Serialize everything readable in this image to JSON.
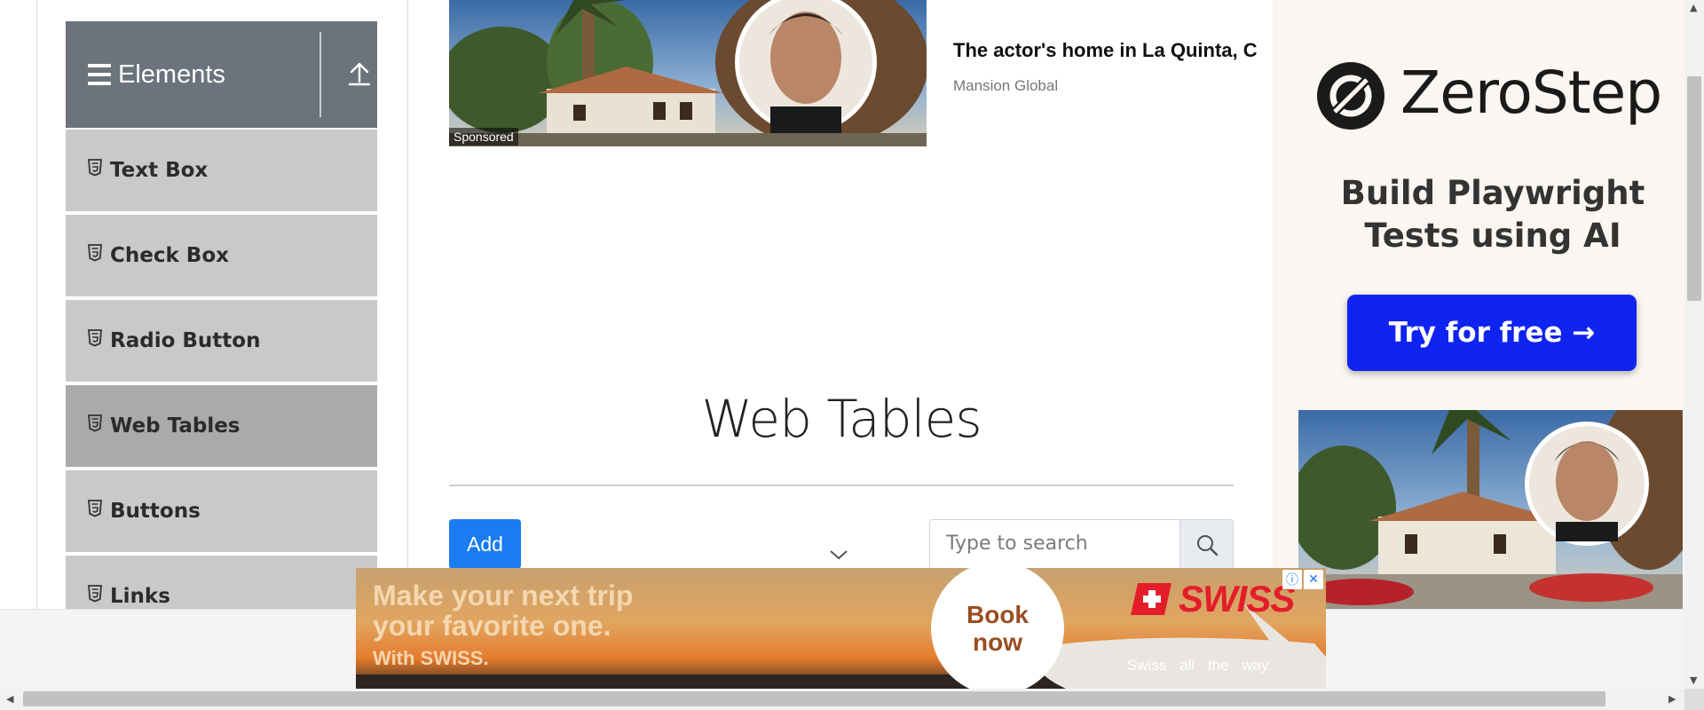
{
  "sidebar": {
    "header_title": "Elements",
    "items": [
      {
        "label": "Text Box"
      },
      {
        "label": "Check Box"
      },
      {
        "label": "Radio Button"
      },
      {
        "label": "Web Tables"
      },
      {
        "label": "Buttons"
      },
      {
        "label": "Links"
      }
    ],
    "active_item": "Web Tables"
  },
  "ad_top": {
    "badge": "Sponsored",
    "title": "The actor's home in La Quinta, C",
    "source": "Mansion Global"
  },
  "main": {
    "page_title": "Web Tables",
    "add_label": "Add",
    "search_placeholder": "Type to search"
  },
  "ad_right": {
    "brand": "ZeroStep",
    "tagline": "Build Playwright Tests using AI",
    "cta": "Try for free →"
  },
  "ad_bottom": {
    "headline_line1": "Make your next trip",
    "headline_line2": "your favorite one.",
    "subline": "With SWISS.",
    "book_line1": "Book",
    "book_line2": "now",
    "brand": "SWISS",
    "slogan": "Swiss all the way."
  },
  "colors": {
    "sidebar_header": "#6b737c",
    "sidebar_item": "#c9c9c9",
    "sidebar_active": "#aaaaaa",
    "primary_button": "#1a7cf0",
    "zerostep_cta": "#0f24f0",
    "swiss_red": "#e41d2a"
  },
  "icons": {
    "menu": "hamburger-icon",
    "collapse": "upload-icon",
    "item": "html5-icon",
    "search": "search-icon",
    "dropdown": "chevron-down-icon",
    "ad_info": "info-icon",
    "ad_close": "close-icon"
  }
}
